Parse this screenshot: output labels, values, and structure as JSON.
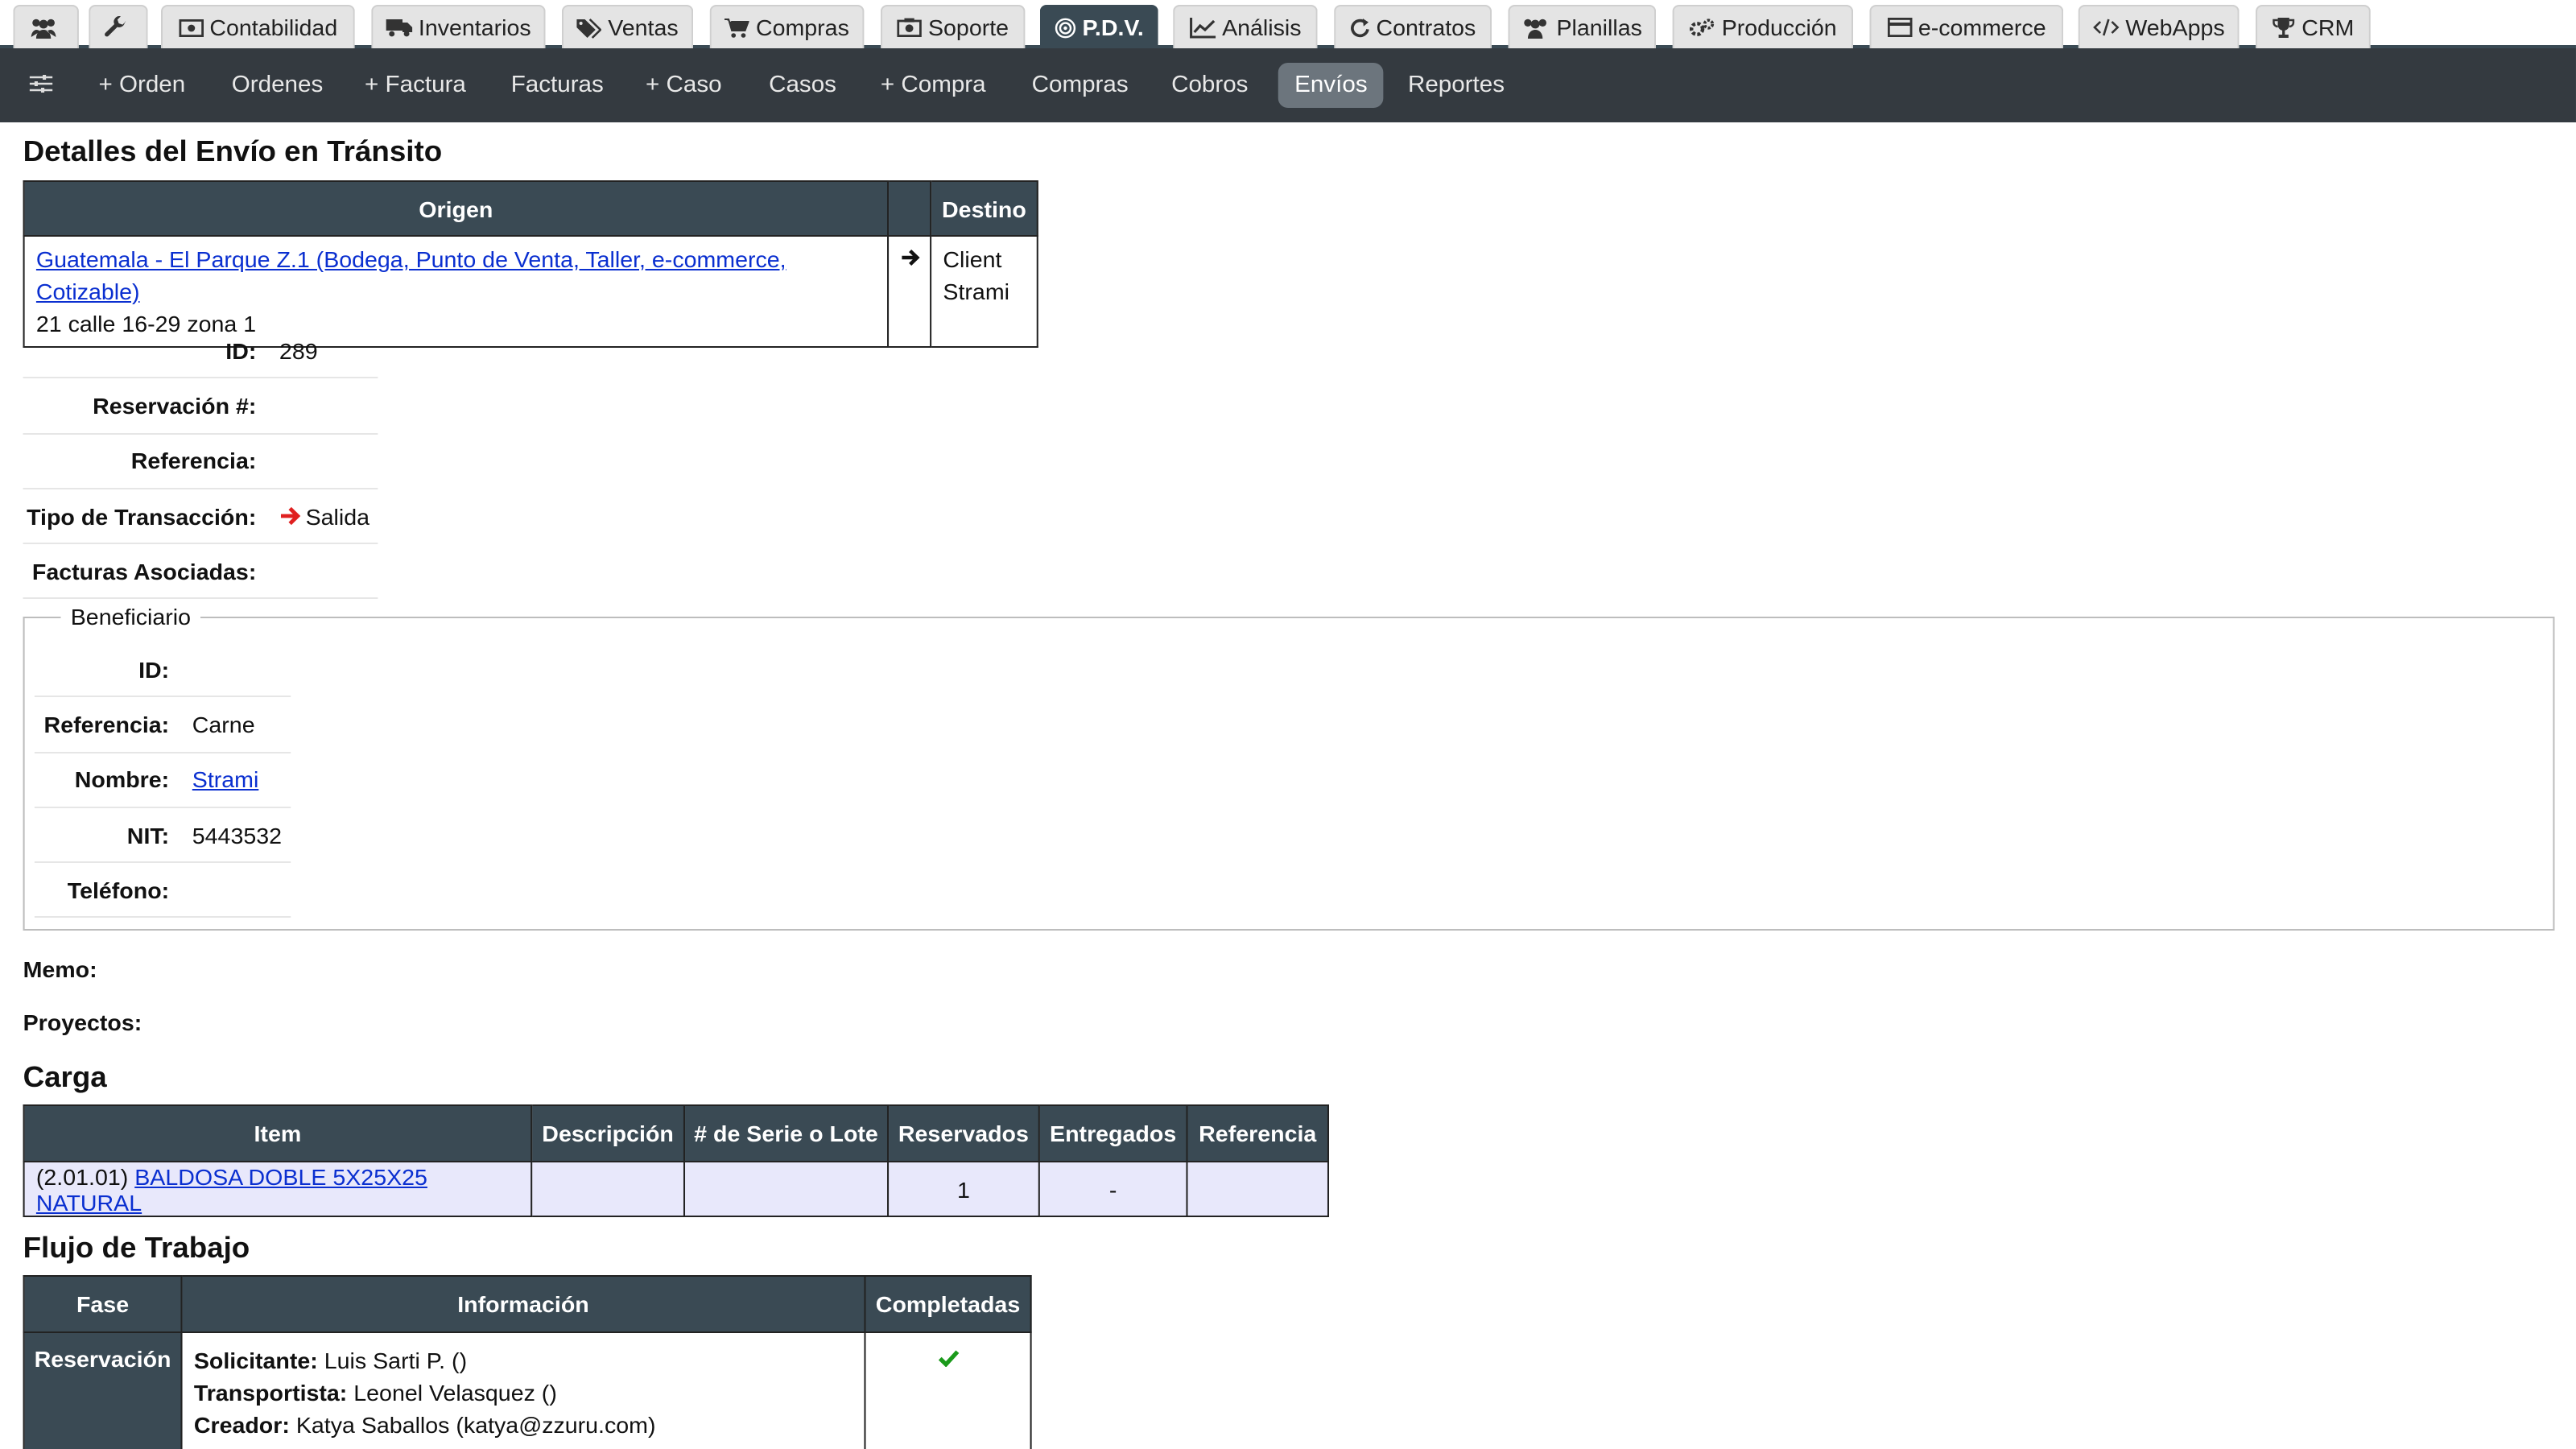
{
  "top_tabs": [
    {
      "label": "",
      "icon": "users-icon"
    },
    {
      "label": "",
      "icon": "wrench-icon"
    },
    {
      "label": "Contabilidad",
      "icon": "money-icon"
    },
    {
      "label": "Inventarios",
      "icon": "truck-icon"
    },
    {
      "label": "Ventas",
      "icon": "tags-icon"
    },
    {
      "label": "Compras",
      "icon": "cart-icon"
    },
    {
      "label": "Soporte",
      "icon": "camera-icon"
    },
    {
      "label": "P.D.V.",
      "icon": "target-icon"
    },
    {
      "label": "Análisis",
      "icon": "chart-icon"
    },
    {
      "label": "Contratos",
      "icon": "refresh-icon"
    },
    {
      "label": "Planillas",
      "icon": "people-icon"
    },
    {
      "label": "Producción",
      "icon": "gears-icon"
    },
    {
      "label": "e-commerce",
      "icon": "card-icon"
    },
    {
      "label": "WebApps",
      "icon": "code-icon"
    },
    {
      "label": "CRM",
      "icon": "trophy-icon"
    }
  ],
  "subnav": {
    "items": [
      "+ Orden",
      "Ordenes",
      "+ Factura",
      "Facturas",
      "+ Caso",
      "Casos",
      "+ Compra",
      "Compras",
      "Cobros",
      "Envíos",
      "Reportes"
    ],
    "active": "Envíos"
  },
  "page_title": "Detalles del Envío en Tránsito",
  "route": {
    "origin_header": "Origen",
    "dest_header": "Destino",
    "origin_link": "Guatemala - El Parque Z.1 (Bodega, Punto de Venta, Taller, e-commerce, Cotizable)",
    "origin_address": "21 calle 16-29 zona 1",
    "dest_line1": "Client",
    "dest_line2": "Strami"
  },
  "details": {
    "id_label": "ID:",
    "id_value": "289",
    "reserva_label": "Reservación #:",
    "reserva_value": "",
    "ref_label": "Referencia:",
    "ref_value": "",
    "tipo_label": "Tipo de Transacción:",
    "tipo_value": "Salida",
    "facturas_label": "Facturas Asociadas:",
    "facturas_value": ""
  },
  "beneficiario": {
    "legend": "Beneficiario",
    "id_label": "ID:",
    "id_value": "",
    "ref_label": "Referencia:",
    "ref_value": "Carne",
    "nombre_label": "Nombre:",
    "nombre_value": "Strami",
    "nit_label": "NIT:",
    "nit_value": "5443532",
    "tel_label": "Teléfono:",
    "tel_value": ""
  },
  "memo_label": "Memo:",
  "proyectos_label": "Proyectos:",
  "carga": {
    "title": "Carga",
    "headers": [
      "Item",
      "Descripción",
      "# de Serie o Lote",
      "Reservados",
      "Entregados",
      "Referencia"
    ],
    "row": {
      "code": "(2.01.01)",
      "item_link": "BALDOSA DOBLE 5X25X25 NATURAL",
      "descripcion": "",
      "serie": "",
      "reservados": "1",
      "entregados": "-",
      "referencia": ""
    }
  },
  "flujo": {
    "title": "Flujo de Trabajo",
    "headers": [
      "Fase",
      "Información",
      "Completadas"
    ],
    "fase": "Reservación",
    "lines": [
      {
        "label": "Solicitante:",
        "value": "Luis Sarti P. ()"
      },
      {
        "label": "Transportista:",
        "value": "Leonel Velasquez ()"
      },
      {
        "label": "Creador:",
        "value": "Katya Saballos (katya@zzuru.com)"
      }
    ]
  },
  "colors": {
    "header": "#3a4a54",
    "subnav": "#343a40",
    "link": "#0a2fd0",
    "arrow_red": "#e02020",
    "check_green": "#1a9a1a",
    "row_tint": "#e8e8fb"
  }
}
